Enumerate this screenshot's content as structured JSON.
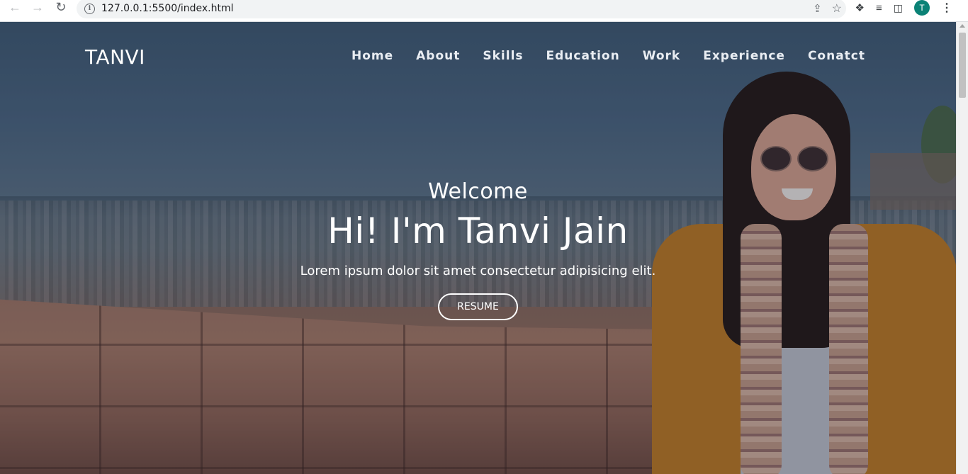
{
  "browser": {
    "url": "127.0.0.1:5500/index.html",
    "back_icon": "arrow-left-icon",
    "forward_icon": "arrow-right-icon",
    "reload_icon": "reload-icon",
    "avatar_letter": "T",
    "avatar_color": "#0b8276"
  },
  "nav": {
    "brand": "TANVI",
    "items": [
      "Home",
      "About",
      "Skills",
      "Education",
      "Work",
      "Experience",
      "Conatct"
    ]
  },
  "hero": {
    "welcome": "Welcome",
    "headline": "Hi! I'm Tanvi Jain",
    "tagline": "Lorem ipsum dolor sit amet consectetur adipisicing elit.",
    "button": "RESUME"
  }
}
